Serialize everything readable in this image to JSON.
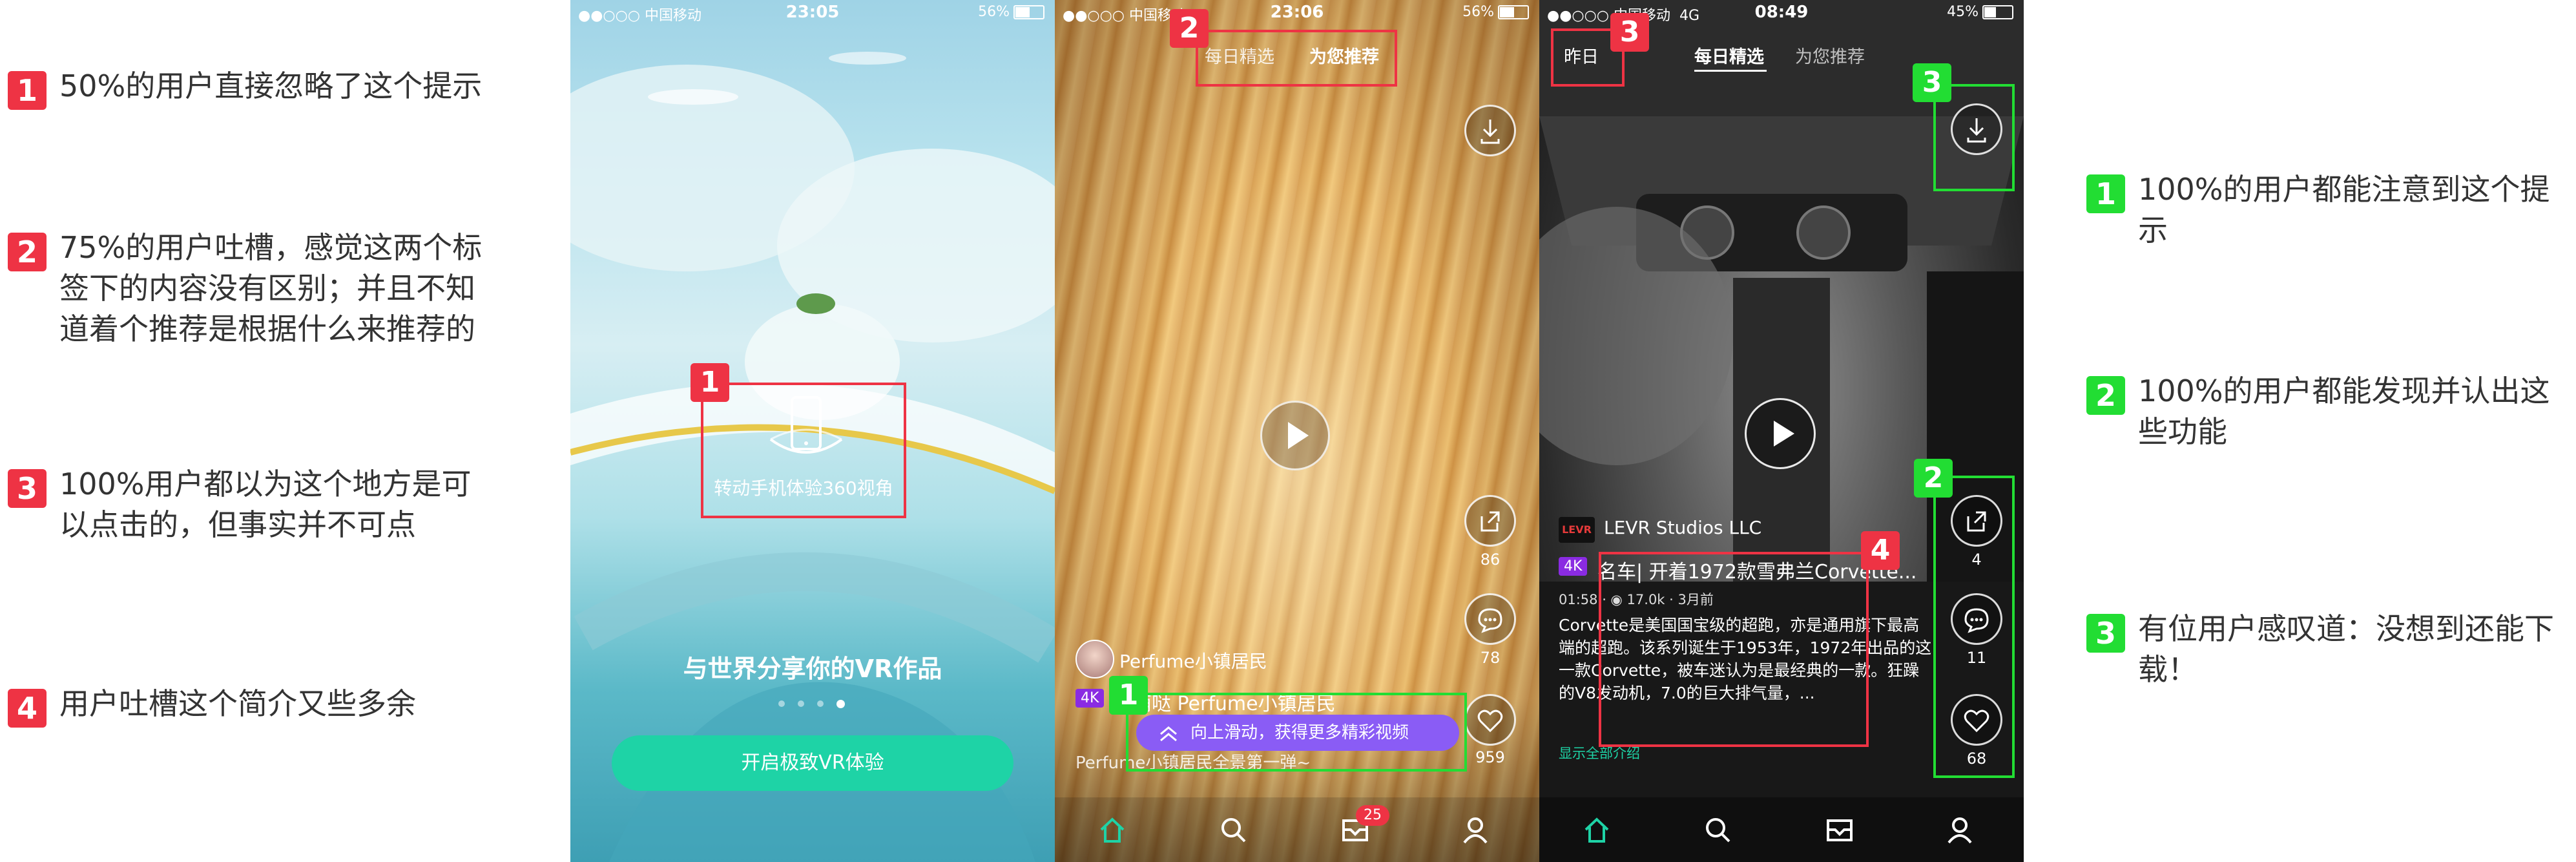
{
  "left_notes": [
    {
      "num": "1",
      "text": "50%的用户直接忽略了这个提示"
    },
    {
      "num": "2",
      "text": "75%的用户吐槽，感觉这两个标签下的内容没有区别；并且不知道着个推荐是根据什么来推荐的"
    },
    {
      "num": "3",
      "text": "100%用户都以为这个地方是可以点击的，但事实并不可点"
    },
    {
      "num": "4",
      "text": "用户吐槽这个简介又些多余"
    }
  ],
  "right_notes": [
    {
      "num": "1",
      "text": "100%的用户都能注意到这个提示"
    },
    {
      "num": "2",
      "text": "100%的用户都能发现并认出这些功能"
    },
    {
      "num": "3",
      "text": "有位用户感叹道：没想到还能下载！"
    }
  ],
  "phone1": {
    "status": {
      "carrier": "●●○○○ 中国移动",
      "time": "23:05",
      "battery": "56%",
      "battery_level": 0.56
    },
    "hint": "转动手机体验360视角",
    "headline": "与世界分享你的VR作品",
    "cta": "开启极致VR体验",
    "page_dots_total": 4,
    "page_dots_active": 4,
    "marker": "1"
  },
  "phone2": {
    "status": {
      "carrier": "●●○○○ 中国移动",
      "time": "23:06",
      "battery": "56%",
      "battery_level": 0.56
    },
    "tabs": [
      "每日精选",
      "为您推荐"
    ],
    "author": "Perfume小镇居民",
    "quality": "4K",
    "title": "萌萌哒 Perfume小镇居民",
    "desc": "Perfume小镇居民全景第一弹~",
    "swipe_hint": "向上滑动，获得更多精彩视频",
    "counts": {
      "comment": "78",
      "like": "959",
      "share": "86"
    },
    "inbox_badge": "25",
    "markers": {
      "tabs": "2",
      "hint": "1"
    }
  },
  "phone3": {
    "status": {
      "carrier": "●●○○○ 中国移动",
      "network": "4G",
      "time": "08:49",
      "battery": "45%",
      "battery_level": 0.45
    },
    "yesterday": "昨日",
    "tabs": [
      "每日精选",
      "为您推荐"
    ],
    "author": "LEVR Studios LLC",
    "author_logo": "LEVR",
    "quality": "4K",
    "title": "名车| 开着1972款雪弗兰Corvette...",
    "meta": "01:58 · ◉ 17.0k · 3月前",
    "desc": "Corvette是美国国宝级的超跑，亦是通用旗下最高端的超跑。该系列诞生于1953年，1972年出品的这一款Corvette，被车迷认为是最经典的一款。狂躁的V8发动机，7.0的巨大排气量，...",
    "show_all": "显示全部介绍",
    "counts": {
      "share": "4",
      "comment": "11",
      "like": "68"
    },
    "markers": {
      "yesterday": "3",
      "download": "3",
      "actions": "2",
      "desc": "4"
    }
  },
  "colors": {
    "accent": "#1ed3a6",
    "mark_red": "#ee3344",
    "mark_green": "#22dd33",
    "hint_purple": "#8a5cf5",
    "quality_badge": "#8a2be2"
  },
  "icons": [
    "phone-rotate-icon",
    "download-icon",
    "play-icon",
    "share-icon",
    "comment-icon",
    "heart-icon",
    "home-icon",
    "search-icon",
    "inbox-icon",
    "profile-icon",
    "double-chevron-up-icon",
    "eye-icon"
  ]
}
